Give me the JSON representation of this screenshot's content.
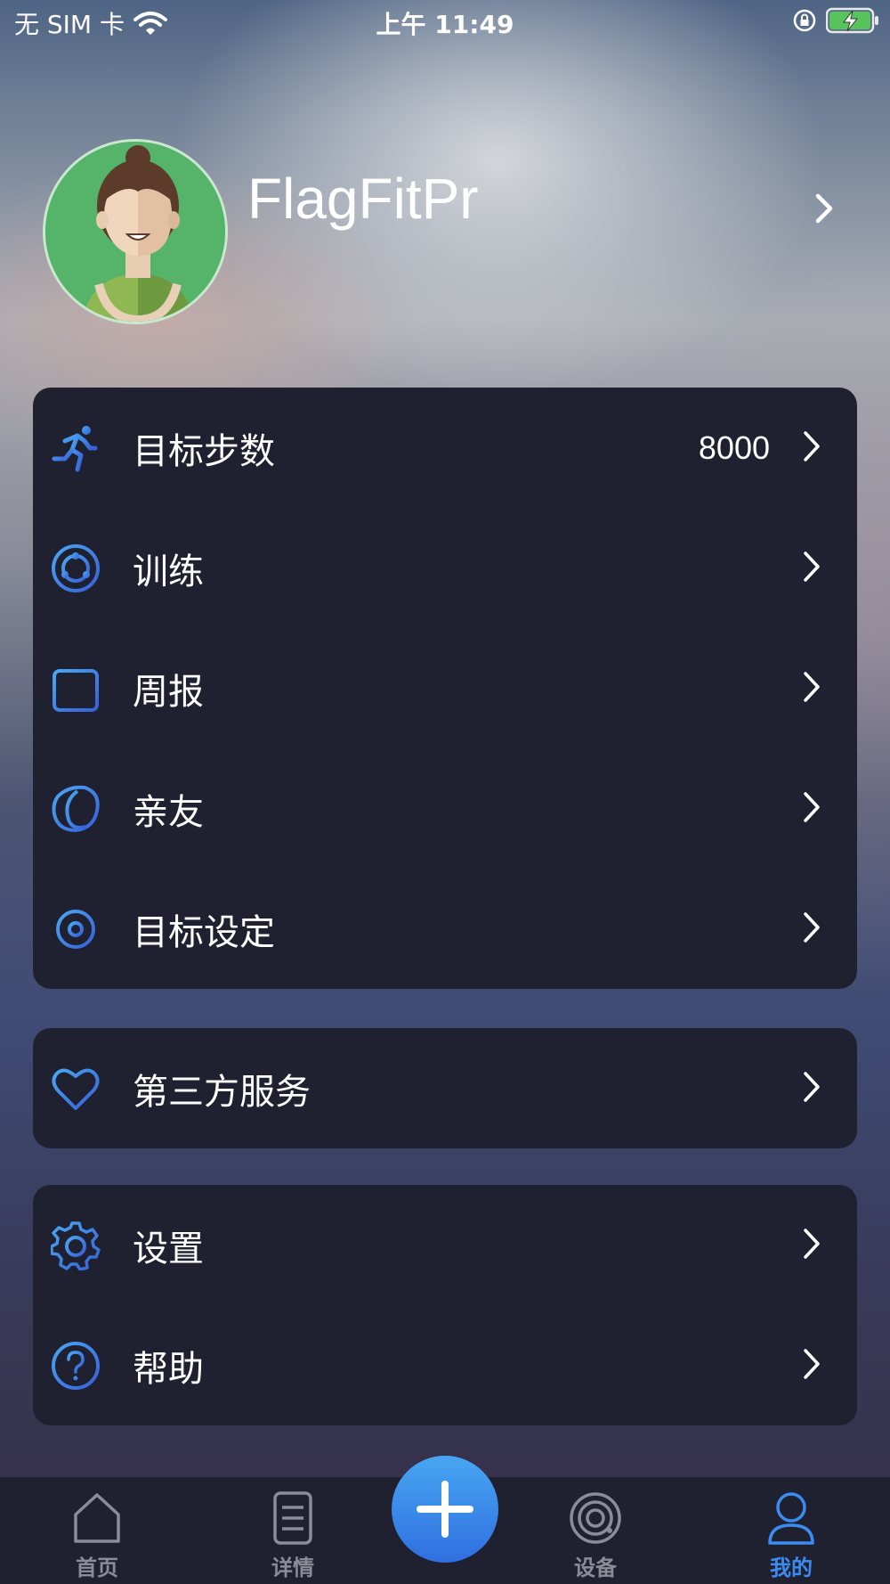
{
  "status_bar": {
    "carrier": "无 SIM 卡",
    "time": "上午 11:49"
  },
  "profile": {
    "username": "FlagFitPr"
  },
  "menu_main": [
    {
      "label": "目标步数",
      "value": "8000",
      "icon": "running-icon"
    },
    {
      "label": "训练",
      "value": "",
      "icon": "training-ring-icon"
    },
    {
      "label": "周报",
      "value": "",
      "icon": "calendar-report-icon"
    },
    {
      "label": "亲友",
      "value": "",
      "icon": "friends-icon"
    },
    {
      "label": "目标设定",
      "value": "",
      "icon": "target-icon"
    }
  ],
  "menu_services": [
    {
      "label": "第三方服务",
      "icon": "heart-icon"
    }
  ],
  "menu_settings": [
    {
      "label": "设置",
      "icon": "gear-icon"
    },
    {
      "label": "帮助",
      "icon": "help-icon"
    }
  ],
  "tabbar": {
    "home": "首页",
    "details": "详情",
    "devices": "设备",
    "mine": "我的",
    "active": "mine"
  },
  "colors": {
    "accent": "#3b8cf0",
    "card_bg": "#1f2030",
    "tab_inactive": "#8a8c98"
  }
}
